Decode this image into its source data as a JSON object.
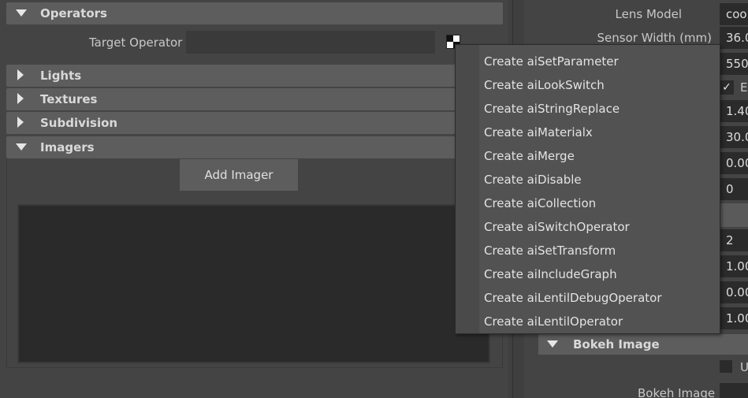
{
  "left": {
    "operators": {
      "title": "Operators",
      "target_label": "Target Operator",
      "target_value": ""
    },
    "sections": [
      {
        "title": "Lights"
      },
      {
        "title": "Textures"
      },
      {
        "title": "Subdivision"
      }
    ],
    "imagers": {
      "title": "Imagers",
      "add_button": "Add Imager"
    }
  },
  "right": {
    "lens_model_label": "Lens Model",
    "lens_model_value": "cook",
    "sensor_width_label": "Sensor Width (mm)",
    "fields": [
      "36.0",
      "550",
      "",
      "1.40",
      "30.0",
      "0.00",
      "0",
      "",
      "2",
      "1.00",
      "0.00",
      "1.00"
    ],
    "check_text": "E",
    "bokeh_header": "Bokeh Image",
    "bokeh_check_text": "U",
    "bokeh_image_label": "Bokeh Image"
  },
  "menu": {
    "items": [
      "Create aiSetParameter",
      "Create aiLookSwitch",
      "Create aiStringReplace",
      "Create aiMaterialx",
      "Create aiMerge",
      "Create aiDisable",
      "Create aiCollection",
      "Create aiSwitchOperator",
      "Create aiSetTransform",
      "Create aiIncludeGraph",
      "Create aiLentilDebugOperator",
      "Create aiLentilOperator"
    ]
  },
  "icons": {
    "target_picker": "object-picker-icon",
    "expand": "triangle-down-icon",
    "collapse": "triangle-right-icon"
  }
}
